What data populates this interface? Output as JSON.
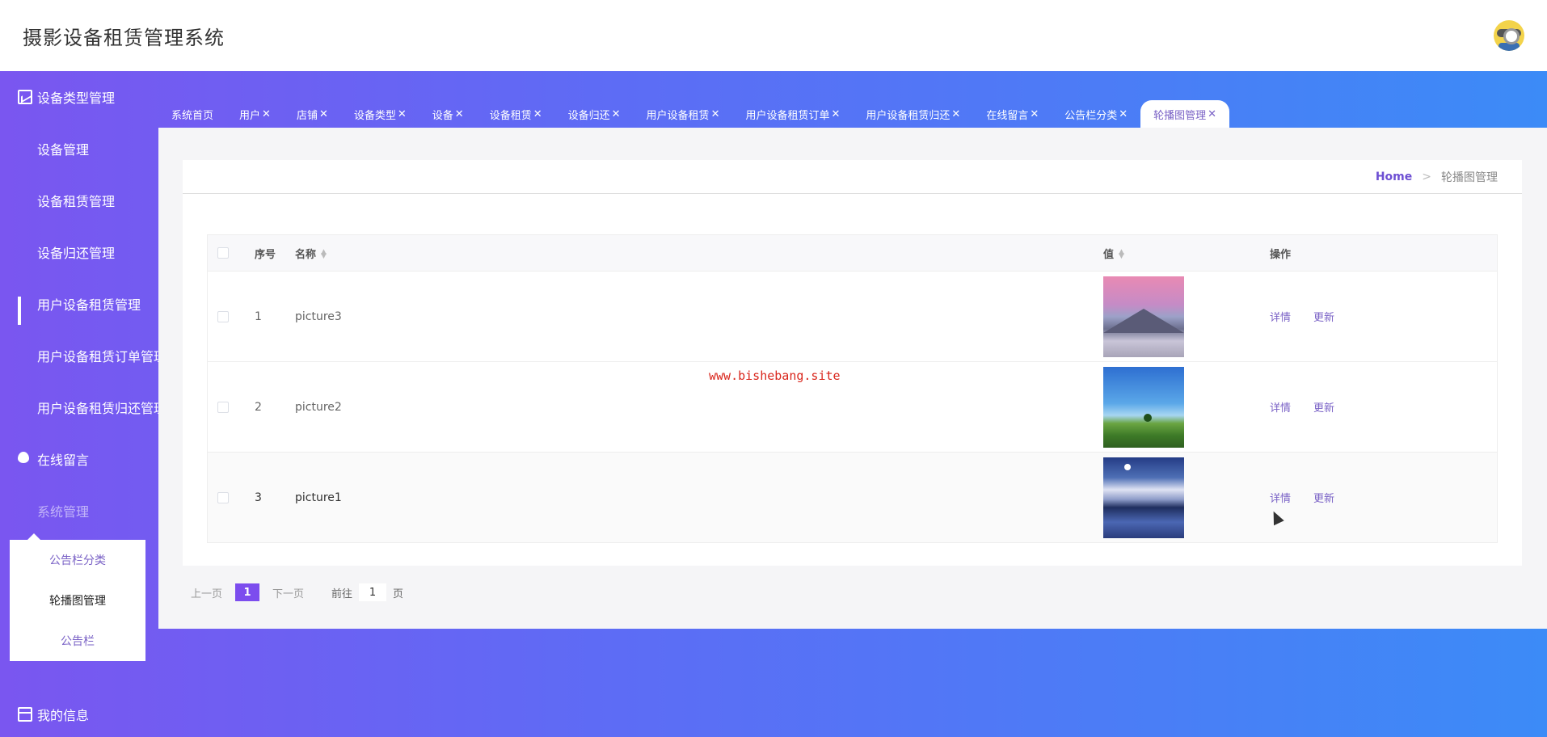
{
  "header": {
    "title": "摄影设备租赁管理系统"
  },
  "sidebar": {
    "items": [
      {
        "label": "设备类型管理",
        "icon": "line-chart-icon"
      },
      {
        "label": "设备管理",
        "icon": "grid-icon"
      },
      {
        "label": "设备租赁管理",
        "icon": "grid-icon"
      },
      {
        "label": "设备归还管理",
        "icon": "grid-icon"
      },
      {
        "label": "用户设备租赁管理",
        "icon": "bar-chart-icon"
      },
      {
        "label": "用户设备租赁订单管理",
        "icon": "grid-icon"
      },
      {
        "label": "用户设备租赁归还管理",
        "icon": "grid-icon"
      },
      {
        "label": "在线留言",
        "icon": "bulb-icon"
      },
      {
        "label": "系统管理",
        "icon": "grid-icon"
      }
    ],
    "submenu": [
      "公告栏分类",
      "轮播图管理",
      "公告栏"
    ],
    "my_info": "我的信息"
  },
  "tabs": [
    {
      "label": "系统首页",
      "close": ""
    },
    {
      "label": "用户",
      "close": "✕"
    },
    {
      "label": "店铺",
      "close": "✕"
    },
    {
      "label": "设备类型",
      "close": "✕"
    },
    {
      "label": "设备",
      "close": "✕"
    },
    {
      "label": "设备租赁",
      "close": "✕"
    },
    {
      "label": "设备归还",
      "close": "✕"
    },
    {
      "label": "用户设备租赁",
      "close": "✕"
    },
    {
      "label": "用户设备租赁订单",
      "close": "✕"
    },
    {
      "label": "用户设备租赁归还",
      "close": "✕"
    },
    {
      "label": "在线留言",
      "close": "✕"
    },
    {
      "label": "公告栏分类",
      "close": "✕"
    },
    {
      "label": "轮播图管理",
      "close": "✕"
    }
  ],
  "breadcrumb": {
    "home": "Home",
    "sep": ">",
    "current": "轮播图管理"
  },
  "table": {
    "headers": {
      "index": "序号",
      "name": "名称",
      "value": "值",
      "ops": "操作"
    },
    "rows": [
      {
        "index": "1",
        "name": "picture3",
        "image": "mountain-pink-sky",
        "detail": "详情",
        "update": "更新"
      },
      {
        "index": "2",
        "name": "picture2",
        "image": "tree-green-field",
        "detail": "详情",
        "update": "更新"
      },
      {
        "index": "3",
        "name": "picture1",
        "image": "snow-lake-moon",
        "detail": "详情",
        "update": "更新"
      }
    ]
  },
  "watermark": "www.bishebang.site",
  "pagination": {
    "prev": "上一页",
    "current": "1",
    "next": "下一页",
    "goto": "前往",
    "page_input": "1",
    "page_unit": "页"
  },
  "colors": {
    "accent": "#7c4dee",
    "link": "#7a62c6",
    "watermark": "#d9261c"
  }
}
